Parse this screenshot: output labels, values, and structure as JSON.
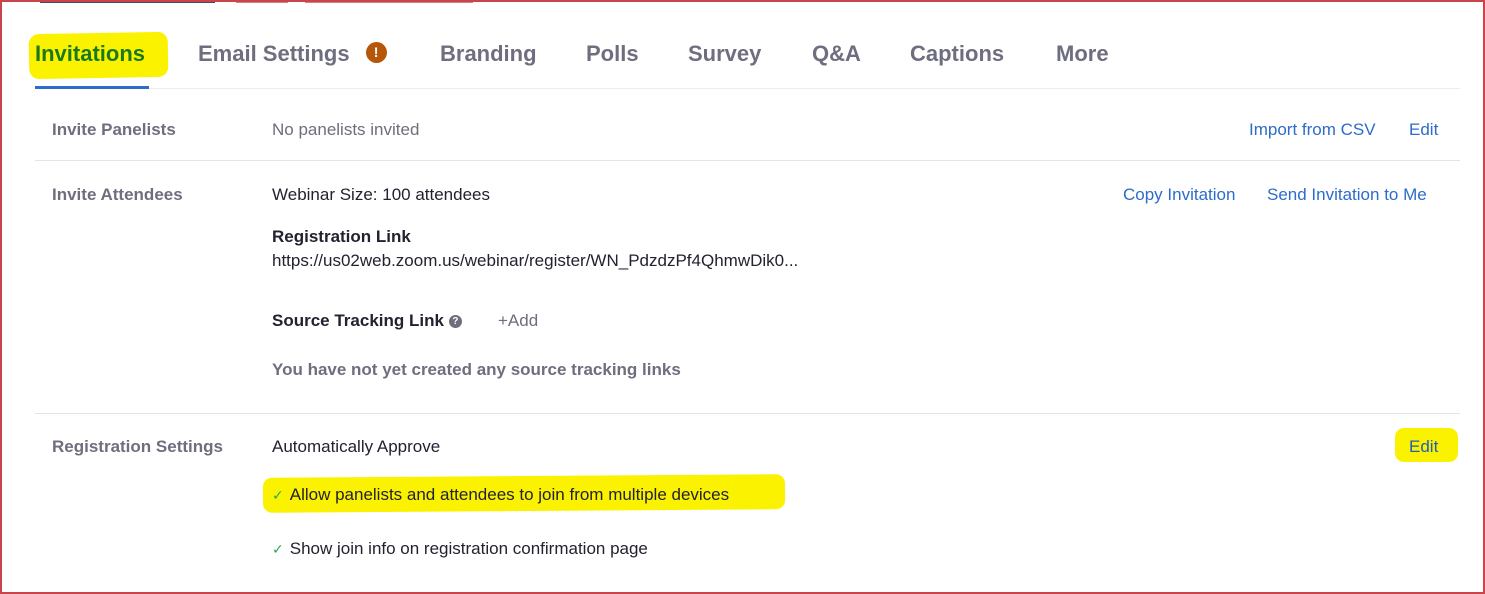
{
  "tabs": [
    {
      "label": "Invitations",
      "active": true
    },
    {
      "label": "Email Settings",
      "warning_icon": "exclamation-icon",
      "warning_glyph": "!"
    },
    {
      "label": "Branding"
    },
    {
      "label": "Polls"
    },
    {
      "label": "Survey"
    },
    {
      "label": "Q&A"
    },
    {
      "label": "Captions"
    },
    {
      "label": "More"
    }
  ],
  "invite_panelists": {
    "label": "Invite Panelists",
    "value": "No panelists invited",
    "actions": [
      "Import from CSV",
      "Edit"
    ]
  },
  "invite_attendees": {
    "label": "Invite Attendees",
    "webinar_size": "Webinar Size: 100 attendees",
    "actions": [
      "Copy Invitation",
      "Send Invitation to Me"
    ],
    "registration_link_label": "Registration Link",
    "registration_link": "https://us02web.zoom.us/webinar/register/WN_PdzdzPf4QhmwDik0...",
    "source_tracking_label": "Source Tracking Link",
    "help_icon": "question-circle-icon",
    "help_glyph": "?",
    "add_label": "+Add",
    "empty_message": "You have not yet created any source tracking links"
  },
  "registration_settings": {
    "label": "Registration Settings",
    "approval": "Automatically Approve",
    "edit_label": "Edit",
    "check_icon": "checkmark-icon",
    "check_glyph": "✓",
    "options": [
      "Allow panelists and attendees to join from multiple devices",
      "Show join info on registration confirmation page"
    ]
  },
  "colors": {
    "accent_blue": "#2d6cc8",
    "active_tab": "#1a7a1a",
    "highlight": "#fbf200",
    "warning": "#b4570a",
    "check_green": "#2fa84f",
    "frame_border": "#c9454b"
  }
}
